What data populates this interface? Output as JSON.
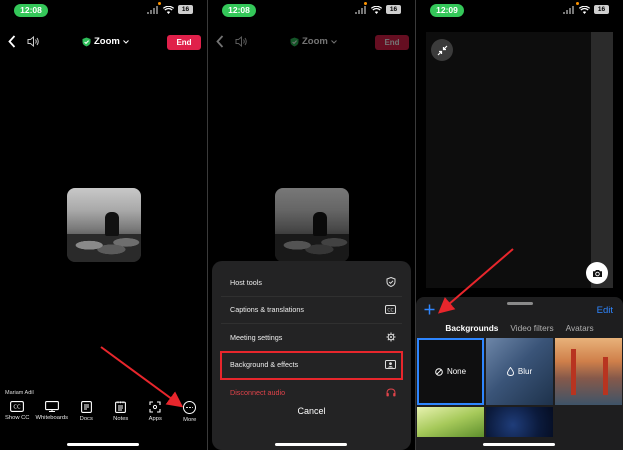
{
  "screens": [
    {
      "status": {
        "time": "12:08",
        "battery": "16"
      },
      "header": {
        "title": "Zoom",
        "end_label": "End"
      },
      "participant_name": "Mariam Adil",
      "toolbar": [
        {
          "icon": "cc-icon",
          "label": "Show CC"
        },
        {
          "icon": "whiteboard-icon",
          "label": "Whiteboards"
        },
        {
          "icon": "docs-icon",
          "label": "Docs"
        },
        {
          "icon": "notes-icon",
          "label": "Notes"
        },
        {
          "icon": "apps-icon",
          "label": "Apps"
        },
        {
          "icon": "more-icon",
          "label": "More"
        }
      ]
    },
    {
      "status": {
        "time": "12:08",
        "battery": "16"
      },
      "header": {
        "title": "Zoom",
        "end_label": "End"
      },
      "menu": [
        {
          "label": "Host tools",
          "icon": "shield-icon"
        },
        {
          "label": "Captions & translations",
          "icon": "cc-icon"
        },
        {
          "label": "Meeting settings",
          "icon": "gear-icon"
        },
        {
          "label": "Background & effects",
          "icon": "portrait-icon",
          "highlighted": true
        },
        {
          "label": "Disconnect audio",
          "icon": "headphones-icon",
          "danger": true
        }
      ],
      "cancel_label": "Cancel"
    },
    {
      "status": {
        "time": "12:09",
        "battery": "16"
      },
      "edit_label": "Edit",
      "tabs": [
        {
          "label": "Backgrounds",
          "active": true
        },
        {
          "label": "Video filters",
          "active": false
        },
        {
          "label": "Avatars",
          "active": false
        }
      ],
      "thumbnails": [
        {
          "label": "None",
          "selected": true
        },
        {
          "label": "Blur",
          "selected": false
        }
      ]
    }
  ],
  "colors": {
    "end_button": "#e0204a",
    "highlight_box": "#e8262c",
    "annotation_arrow": "#e8262c",
    "accent_blue": "#2e86ff",
    "status_pill": "#34c759",
    "danger_text": "#e0434a"
  }
}
